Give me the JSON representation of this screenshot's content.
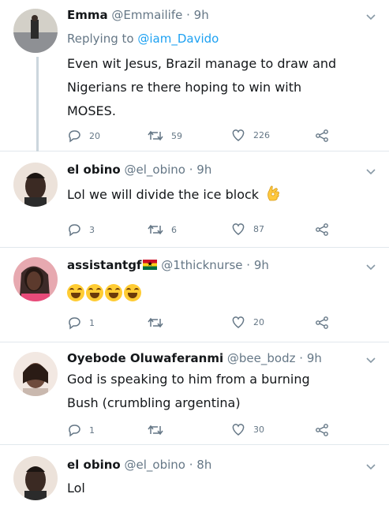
{
  "tweets": [
    {
      "name": "Emma",
      "handle": "@Emmailife",
      "time": "9h",
      "replying_label": "Replying to",
      "replying_to": "@iam_Davido",
      "text_lines": [
        "Even wit Jesus, Brazil manage to draw and",
        "Nigerians re there hoping to win with",
        "MOSES."
      ],
      "replies": "20",
      "retweets": "59",
      "likes": "226",
      "avatar_colors": [
        "#c9c6bf",
        "#8a8d91"
      ]
    },
    {
      "name": "el obino",
      "handle": "@el_obino",
      "time": "9h",
      "text_lines": [
        "Lol we will divide the ice block"
      ],
      "emoji": "ok-hand",
      "replies": "3",
      "retweets": "6",
      "likes": "87",
      "avatar_colors": [
        "#e8d9cf",
        "#3a2a24"
      ]
    },
    {
      "name": "assistantgf",
      "flag": "ghana-flag",
      "handle": "@1thicknurse",
      "time": "9h",
      "emoji_count_label": "",
      "replies": "1",
      "retweets": "",
      "likes": "20",
      "avatar_colors": [
        "#e2a0a8",
        "#3b2620"
      ]
    },
    {
      "name": "Oyebode Oluwaferanmi",
      "handle": "@bee_bodz",
      "time": "9h",
      "text_lines": [
        "God is speaking to him from a burning",
        "Bush (crumbling argentina)"
      ],
      "replies": "1",
      "retweets": "",
      "likes": "30",
      "avatar_colors": [
        "#efe3dd",
        "#6b4a3b"
      ]
    },
    {
      "name": "el obino",
      "handle": "@el_obino",
      "time": "8h",
      "text_lines": [
        "Lol"
      ],
      "avatar_colors": [
        "#e8d9cf",
        "#3a2a24"
      ]
    }
  ],
  "dot": "·"
}
